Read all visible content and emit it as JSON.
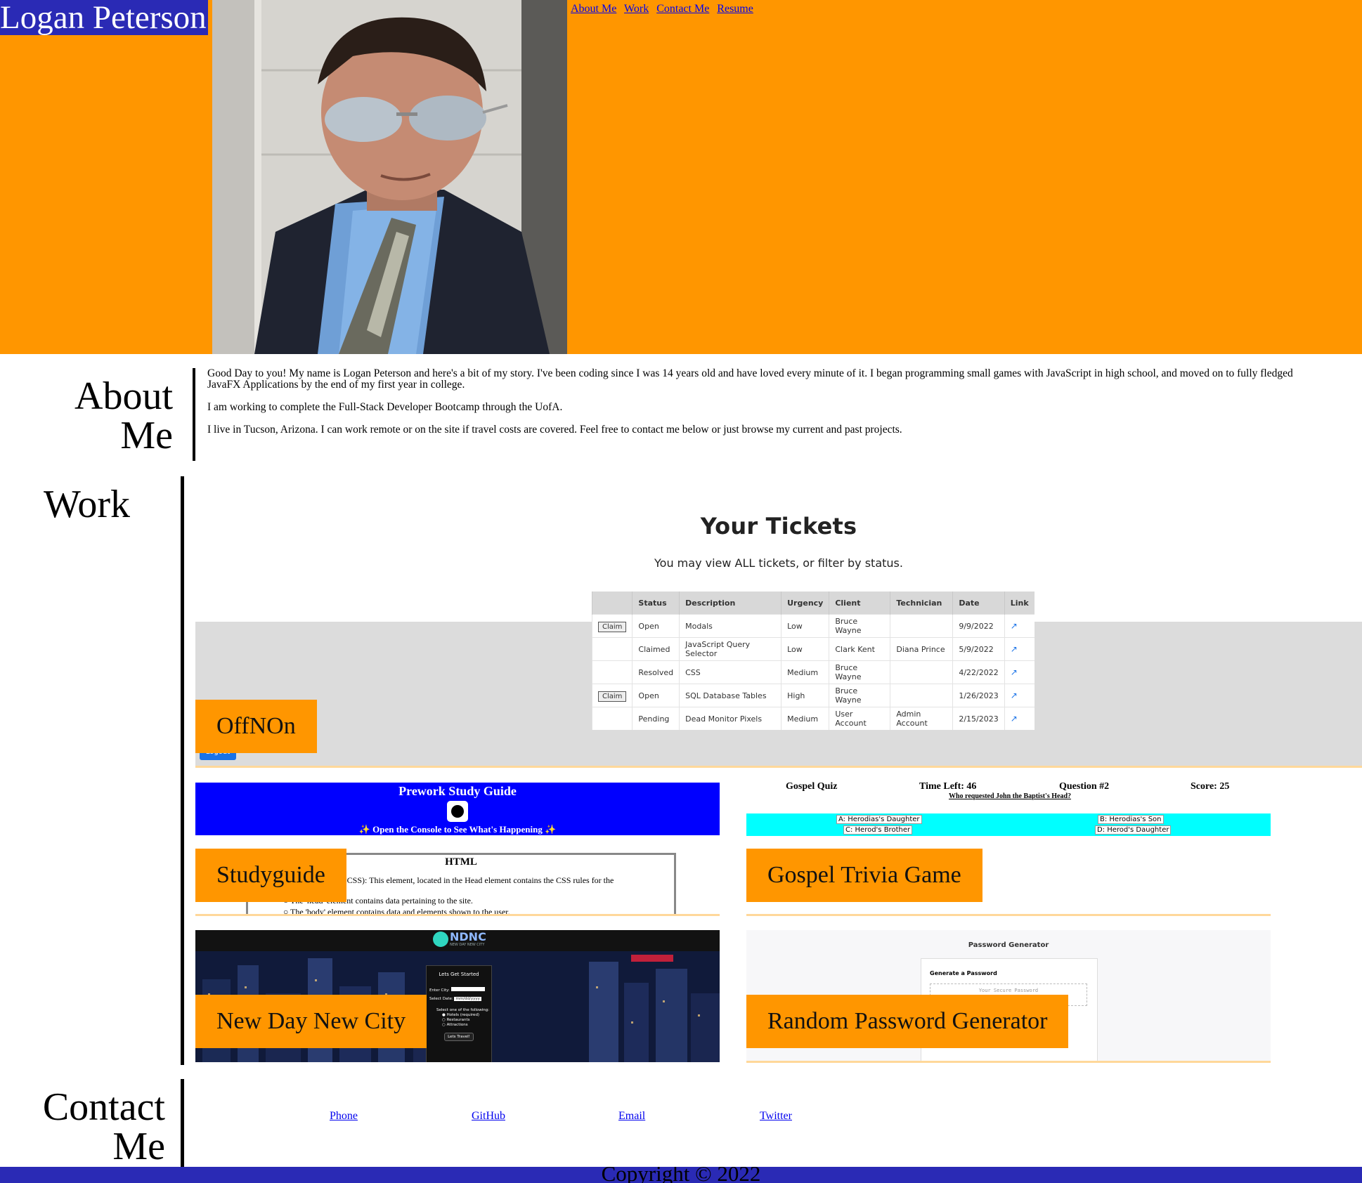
{
  "header": {
    "title": "Logan Peterson",
    "nav": [
      "About Me",
      "Work",
      "Contact Me",
      "Resume"
    ],
    "colors": {
      "header_bg": "#ff9600",
      "title_bg": "#2a2ab5"
    }
  },
  "about": {
    "title_line1": "About",
    "title_line2": "Me",
    "paragraphs": [
      "Good Day to you! My name is Logan Peterson and here's a bit of my story. I've been coding since I was 14 years old and have loved every minute of it. I began programming small games with JavaScript in high school, and moved on to fully fledged JavaFX Applications by the end of my first year in college.",
      "I am working to complete the Full-Stack Developer Bootcamp through the UofA.",
      "I live in Tucson, Arizona. I can work remote or on the site if travel costs are covered. Feel free to contact me below or just browse my current and past projects."
    ]
  },
  "work": {
    "title": "Work",
    "projects": [
      {
        "label": "OffNOn",
        "preview": {
          "heading": "Your Tickets",
          "subheading": "You may view ALL tickets, or filter by status.",
          "columns": [
            "",
            "Status",
            "Description",
            "Urgency",
            "Client",
            "Technician",
            "Date",
            "Link"
          ],
          "rows": [
            [
              "Claim",
              "Open",
              "Modals",
              "Low",
              "Bruce Wayne",
              "",
              "9/9/2022",
              "↗"
            ],
            [
              "",
              "Claimed",
              "JavaScript Query Selector",
              "Low",
              "Clark Kent",
              "Diana Prince",
              "5/9/2022",
              "↗"
            ],
            [
              "",
              "Resolved",
              "CSS",
              "Medium",
              "Bruce Wayne",
              "",
              "4/22/2022",
              "↗"
            ],
            [
              "Claim",
              "Open",
              "SQL Database Tables",
              "High",
              "Bruce Wayne",
              "",
              "1/26/2023",
              "↗"
            ],
            [
              "",
              "Pending",
              "Dead Monitor Pixels",
              "Medium",
              "User Account",
              "Admin Account",
              "2/15/2023",
              "↗"
            ]
          ],
          "logout": "Logout"
        }
      },
      {
        "label": "Studyguide",
        "preview": {
          "banner_title": "Prework Study Guide",
          "banner_sub": "✨ Open the Console to See What's Happening ✨",
          "section_title": "HTML",
          "line1": "t (Internal CSS): This element, located in the Head element contains the CSS rules for the",
          "line2": "The 'head' element contains data pertaining to the site.",
          "line3": "The 'body' element contains data and elements shown to the user."
        }
      },
      {
        "label": "Gospel Trivia Game",
        "preview": {
          "name": "Gospel Quiz",
          "time": "Time Left: 46",
          "question_no": "Question #2",
          "score": "Score: 25",
          "question": "Who requested John the Baptist's Head?",
          "answers": [
            "A: Herodias's Daughter",
            "B: Herodias's Son",
            "C: Herod's Brother",
            "D: Herod's Daughter"
          ]
        }
      },
      {
        "label": "New Day New City",
        "preview": {
          "logo": "NDNC",
          "logo_sub": "NEW DAY NEW CITY",
          "card_title": "Lets Get Started",
          "city_label": "Enter City:",
          "date_label": "Select Date:",
          "date_value": "mm/dd/yyyy",
          "choose_label": "Select one of the following:",
          "options": [
            "Hotels (required)",
            "Restaurants",
            "Attractions"
          ],
          "button": "Lets Travel!"
        }
      },
      {
        "label": "Random Password Generator",
        "preview": {
          "title": "Password Generator",
          "card_title": "Generate a Password",
          "placeholder": "Your Secure Password"
        }
      }
    ]
  },
  "contact": {
    "title_line1": "Contact",
    "title_line2": "Me",
    "links": [
      "Phone",
      "GitHub",
      "Email",
      "Twitter"
    ]
  },
  "footer": {
    "text": "Copyright © 2022"
  }
}
